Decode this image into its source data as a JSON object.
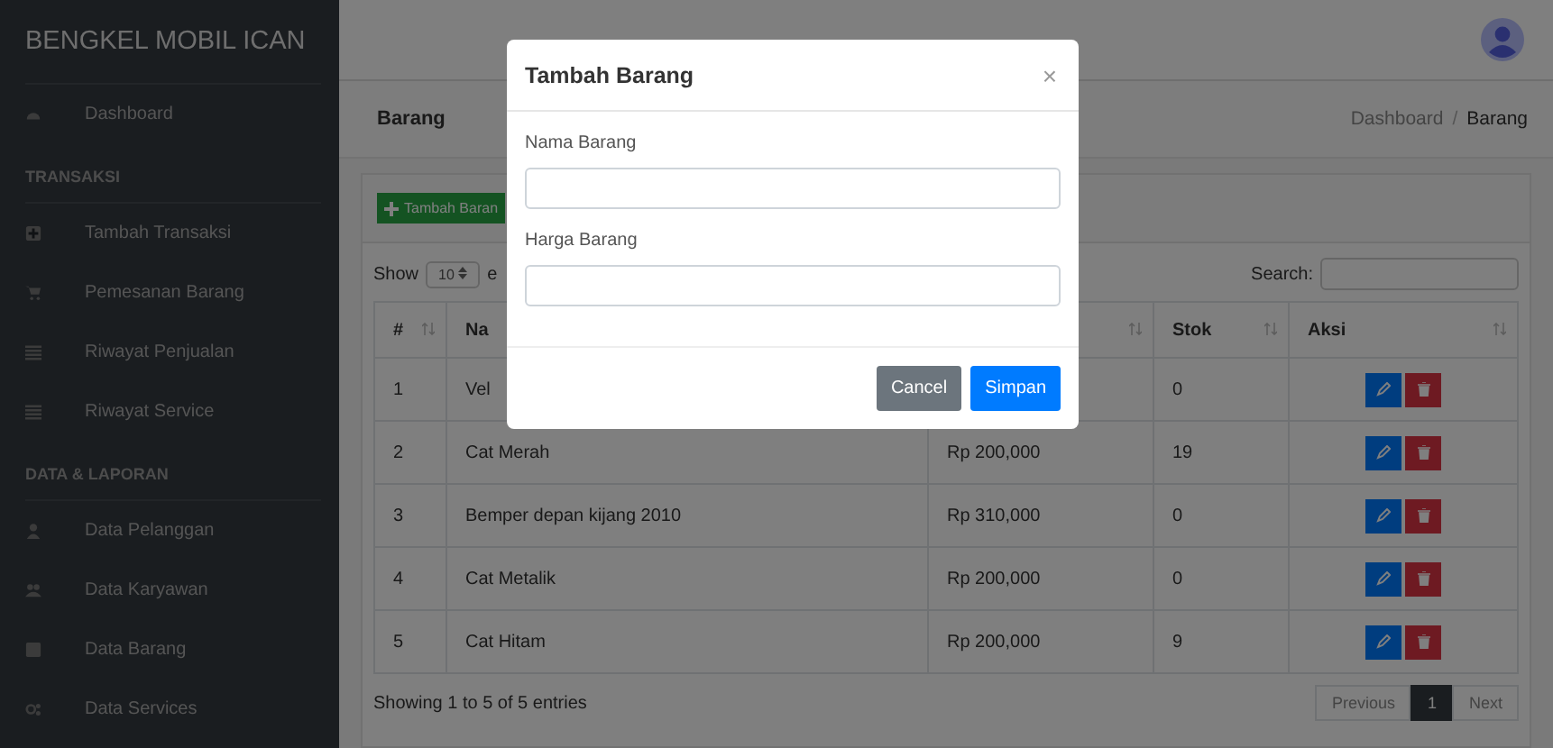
{
  "sidebar": {
    "brand": "BENGKEL MOBIL ICAN",
    "sections": [
      {
        "items": [
          {
            "label": "Dashboard"
          }
        ]
      },
      {
        "heading": "TRANSAKSI",
        "items": [
          {
            "label": "Tambah Transaksi"
          },
          {
            "label": "Pemesanan Barang"
          },
          {
            "label": "Riwayat Penjualan"
          },
          {
            "label": "Riwayat Service"
          }
        ]
      },
      {
        "heading": "DATA & LAPORAN",
        "items": [
          {
            "label": "Data Pelanggan"
          },
          {
            "label": "Data Karyawan"
          },
          {
            "label": "Data Barang"
          },
          {
            "label": "Data Services"
          }
        ]
      }
    ]
  },
  "page": {
    "title": "Barang",
    "breadcrumb_separator": "/",
    "breadcrumb": [
      {
        "label": "Dashboard",
        "active": false
      },
      {
        "label": "Barang",
        "active": true
      }
    ]
  },
  "toolbar": {
    "add_button": "Tambah Baran"
  },
  "table_controls": {
    "show_label": "Show",
    "page_size": "10",
    "entries_label": "e",
    "search_label": "Search:"
  },
  "table": {
    "columns": [
      {
        "label": "#"
      },
      {
        "label": "Na"
      },
      {},
      {
        "label": "Stok"
      },
      {
        "label": "Aksi"
      }
    ],
    "rows": [
      {
        "cells": [
          {
            "text": "1"
          },
          {
            "text": "Vel"
          },
          {},
          {
            "text": "0"
          }
        ]
      },
      {
        "cells": [
          {
            "text": "2"
          },
          {
            "text": "Cat Merah"
          },
          {
            "text": "Rp 200,000"
          },
          {
            "text": "19"
          }
        ]
      },
      {
        "cells": [
          {
            "text": "3"
          },
          {
            "text": "Bemper depan kijang 2010"
          },
          {
            "text": "Rp 310,000"
          },
          {
            "text": "0"
          }
        ]
      },
      {
        "cells": [
          {
            "text": "4"
          },
          {
            "text": "Cat Metalik"
          },
          {
            "text": "Rp 200,000"
          },
          {
            "text": "0"
          }
        ]
      },
      {
        "cells": [
          {
            "text": "5"
          },
          {
            "text": "Cat Hitam"
          },
          {
            "text": "Rp 200,000"
          },
          {
            "text": "9"
          }
        ]
      }
    ]
  },
  "footer": {
    "info": "Showing 1 to 5 of 5 entries",
    "pagination": [
      {
        "label": "Previous",
        "selected": false
      },
      {
        "label": "1",
        "selected": true
      },
      {
        "label": "Next",
        "selected": false
      }
    ]
  },
  "modal": {
    "title": "Tambah Barang",
    "close": "×",
    "fields": [
      {
        "label": "Nama Barang"
      },
      {
        "label": "Harga Barang"
      }
    ],
    "buttons": [
      {
        "label": "Cancel",
        "kind": "secondary"
      },
      {
        "label": "Simpan",
        "kind": "primary"
      }
    ]
  }
}
